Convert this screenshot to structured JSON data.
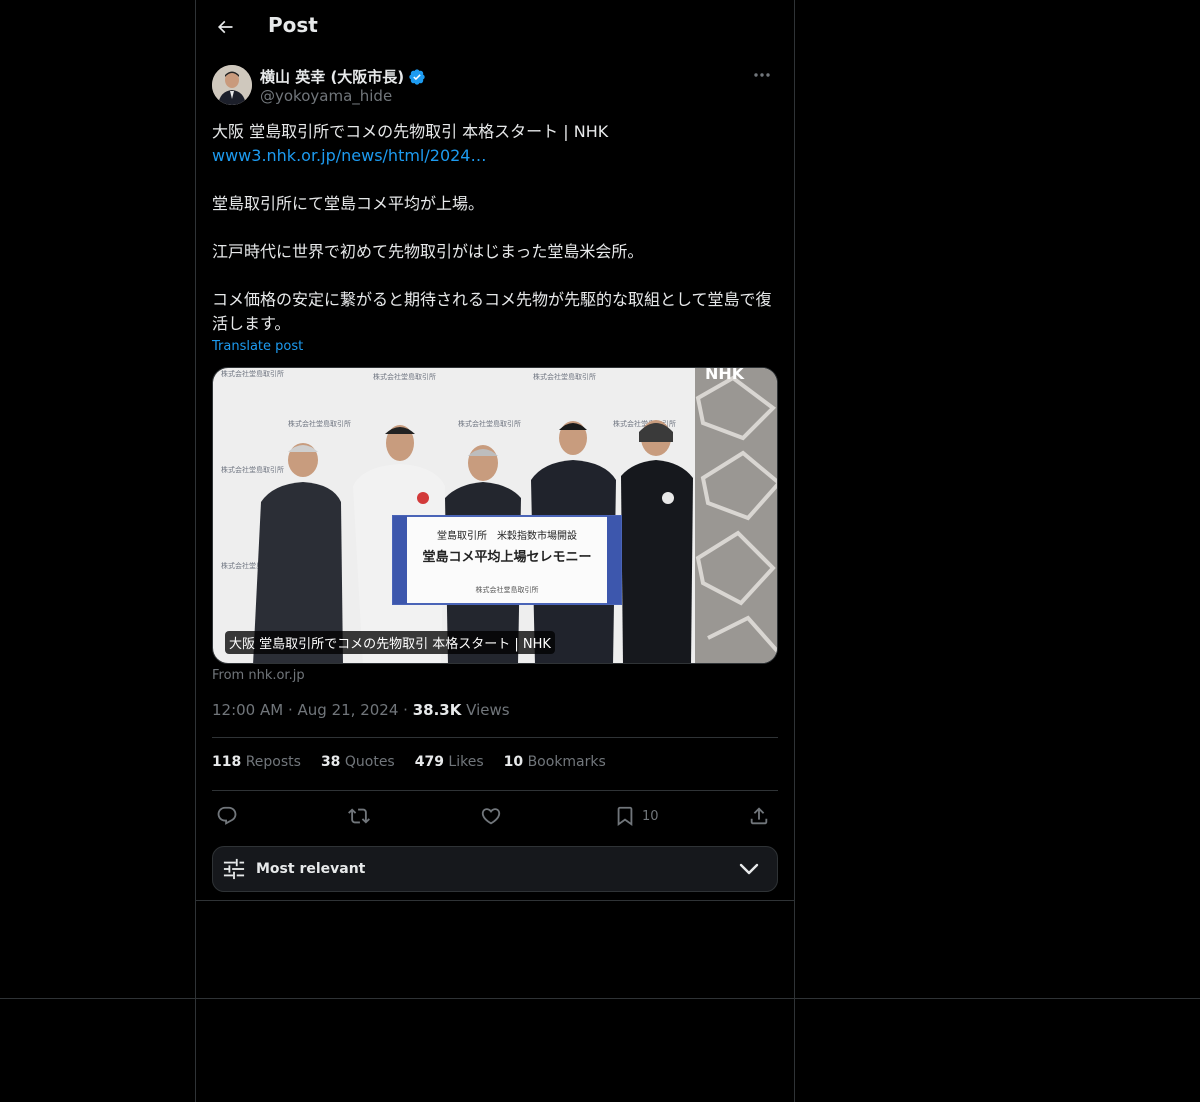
{
  "header": {
    "title": "Post"
  },
  "author": {
    "name": "横山 英幸 (大阪市長)",
    "handle": "@yokoyama_hide",
    "verified": true
  },
  "post": {
    "line1": "大阪 堂島取引所でコメの先物取引 本格スタート | NHK",
    "link": "www3.nhk.or.jp/news/html/2024…",
    "para1": "堂島取引所にて堂島コメ平均が上場。",
    "para2": "江戸時代に世界で初めて先物取引がはじまった堂島米会所。",
    "para3": "コメ価格の安定に繋がると期待されるコメ先物が先駆的な取組として堂島で復活します。",
    "translate_label": "Translate post"
  },
  "media": {
    "caption": "大阪 堂島取引所でコメの先物取引 本格スタート | NHK",
    "source": "From nhk.or.jp",
    "broadcaster_logo": "NHK",
    "banner_line1": "堂島取引所　米穀指数市場開設",
    "banner_line2": "堂島コメ平均上場セレモニー",
    "banner_footer": "株式会社堂島取引所",
    "backdrop_text": "株式会社堂島取引所"
  },
  "meta": {
    "time": "12:00 AM",
    "date": "Aug 21, 2024",
    "views_count": "38.3K",
    "views_label": "Views"
  },
  "stats": {
    "reposts_count": "118",
    "reposts_label": "Reposts",
    "quotes_count": "38",
    "quotes_label": "Quotes",
    "likes_count": "479",
    "likes_label": "Likes",
    "bookmarks_count": "10",
    "bookmarks_label": "Bookmarks"
  },
  "actions": {
    "reply_icon": "reply-icon",
    "repost_icon": "repost-icon",
    "like_icon": "heart-icon",
    "bookmark_icon": "bookmark-icon",
    "bookmark_count": "10",
    "share_icon": "share-icon"
  },
  "sort": {
    "label": "Most relevant"
  },
  "colors": {
    "background": "#000000",
    "text": "#e7e9ea",
    "muted": "#71767b",
    "accent": "#1d9bf0",
    "border": "#2f3336"
  }
}
